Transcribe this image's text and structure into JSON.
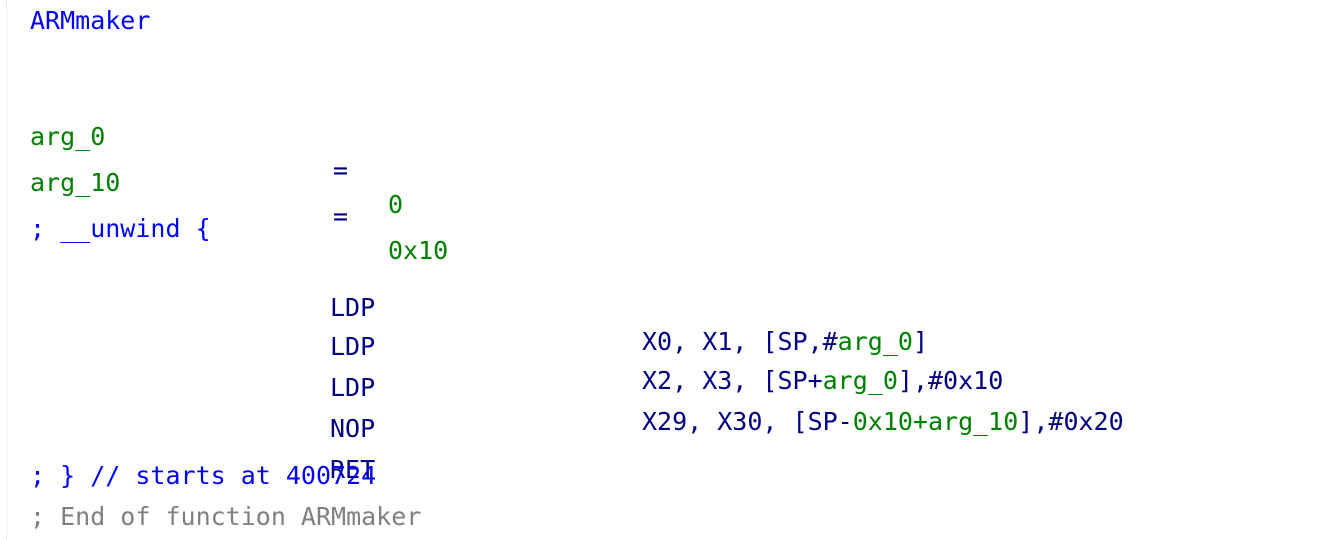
{
  "function": {
    "name": "ARMmaker"
  },
  "args": [
    {
      "name": "arg_0",
      "op": "=",
      "value": "0"
    },
    {
      "name": "arg_10",
      "op": "=",
      "value": "0x10"
    }
  ],
  "unwind_start": "; __unwind {",
  "instructions": [
    {
      "mnemonic": "LDP",
      "parts": [
        "X0, X1, [SP,#",
        "arg_0",
        "]"
      ]
    },
    {
      "mnemonic": "LDP",
      "parts": [
        "X2, X3, [SP+",
        "arg_0",
        "],#0x10"
      ]
    },
    {
      "mnemonic": "LDP",
      "parts": [
        "X29, X30, [SP-",
        "0x10+arg_10",
        "],#0x20"
      ]
    },
    {
      "mnemonic": "NOP",
      "parts": []
    },
    {
      "mnemonic": "RET",
      "parts": []
    }
  ],
  "unwind_end": "; } // starts at 400724",
  "end_comment": "; End of function ARMmaker",
  "colors": {
    "label": "#0000ff",
    "mnemonic": "#000080",
    "operand": "#000080",
    "symbol": "#008000",
    "comment": "#808080"
  }
}
